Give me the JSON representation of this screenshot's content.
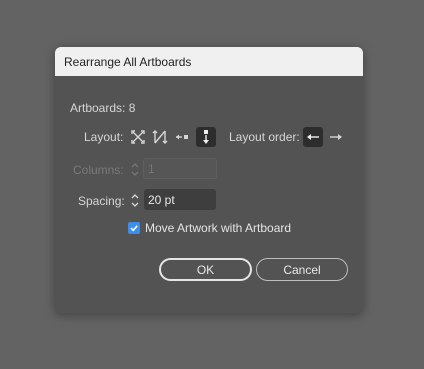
{
  "dialog": {
    "title": "Rearrange All Artboards",
    "artboards_label": "Artboards: 8",
    "layout_label": "Layout:",
    "layout_options": [
      {
        "icon": "grid-by-row-icon",
        "selected": false
      },
      {
        "icon": "grid-by-column-icon",
        "selected": false
      },
      {
        "icon": "arrange-by-row-icon",
        "selected": false
      },
      {
        "icon": "arrange-by-column-icon",
        "selected": true
      }
    ],
    "layout_order_label": "Layout order:",
    "layout_order_options": [
      {
        "icon": "left-to-right-icon",
        "selected": true
      },
      {
        "icon": "right-to-left-icon",
        "selected": false
      }
    ],
    "columns_label": "Columns:",
    "columns_value": "1",
    "spacing_label": "Spacing:",
    "spacing_value": "20 pt",
    "move_artwork_label": "Move Artwork with Artboard",
    "move_artwork_checked": true,
    "ok_label": "OK",
    "cancel_label": "Cancel"
  },
  "colors": {
    "background": "#636363",
    "dialog": "#535353",
    "titlebar": "#f0f0f0",
    "accent": "#3d8ee8"
  }
}
